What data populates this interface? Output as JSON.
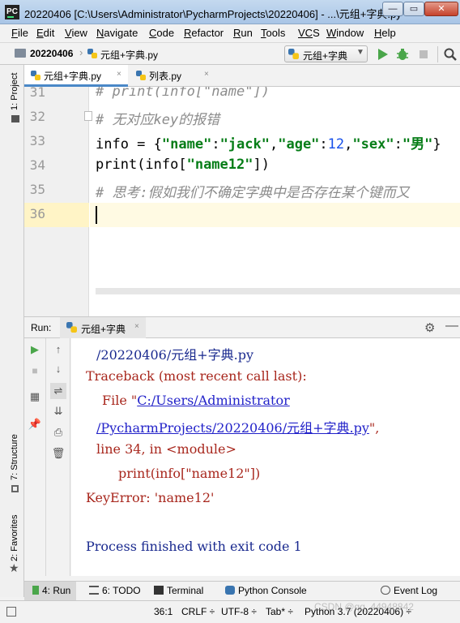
{
  "window": {
    "app_icon_text": "PC",
    "title": "20220406 [C:\\Users\\Administrator\\PycharmProjects\\20220406] - ...\\元组+字典.py",
    "minimize": "—",
    "maximize": "▭",
    "close": "✕"
  },
  "menu": [
    {
      "mn": "F",
      "rest": "ile"
    },
    {
      "mn": "E",
      "rest": "dit"
    },
    {
      "mn": "V",
      "rest": "iew"
    },
    {
      "mn": "N",
      "rest": "avigate"
    },
    {
      "mn": "C",
      "rest": "ode"
    },
    {
      "mn": "R",
      "rest": "efactor"
    },
    {
      "mn": "R",
      "rest": "un"
    },
    {
      "mn": "T",
      "rest": "ools"
    },
    {
      "mn": "VC",
      "rest": "S"
    },
    {
      "mn": "W",
      "rest": "indow"
    },
    {
      "mn": "H",
      "rest": "elp"
    }
  ],
  "nav": {
    "project": "20220406",
    "file": "元组+字典.py",
    "run_config": "元组+字典"
  },
  "left_strip": {
    "project": "1: Project",
    "structure": "7: Structure",
    "favorites": "2: Favorites"
  },
  "tabs": [
    {
      "label": "元组+字典.py",
      "close": "×"
    },
    {
      "label": "列表.py",
      "close": "×"
    }
  ],
  "editor": {
    "line_numbers": [
      "31",
      "32",
      "33",
      "34",
      "35",
      "36"
    ],
    "line31": "# print(info[\"name\"])",
    "line32": "# 无对应key的报错",
    "l33_a": "info = {",
    "l33_s1": "\"name\"",
    "l33_c1": ":",
    "l33_s2": "\"jack\"",
    "l33_c2": ",",
    "l33_s3": "\"age\"",
    "l33_c3": ":",
    "l33_n": "12",
    "l33_c4": ",",
    "l33_s4": "\"sex\"",
    "l33_c5": ":",
    "l33_s5": "\"男\"",
    "l33_end": "}",
    "l34_a": "print(info[",
    "l34_s": "\"name12\"",
    "l34_end": "])",
    "line35": "# 思考:假如我们不确定字典中是否存在某个键而又"
  },
  "run_panel": {
    "label": "Run:",
    "tab": "元组+字典",
    "close": "×",
    "gear": "⚙",
    "minimize": "—"
  },
  "console": {
    "line1": "/20220406/元组+字典.py",
    "line2": "Traceback (most recent call last):",
    "line3_pre": "File \"",
    "line3_link": "C:/Users/Administrator",
    "line4_link": "/PycharmProjects/20220406/元组+字典.py",
    "line4_post": "\",",
    "line5": "line 34, in <module>",
    "line6": "print(info[\"name12\"])",
    "line7": "KeyError: 'name12'",
    "line8": "Process finished with exit code 1"
  },
  "bottom_tabs": {
    "run": "4: Run",
    "todo": "6: TODO",
    "terminal": "Terminal",
    "python_console": "Python Console",
    "event_log": "Event Log"
  },
  "status": {
    "position": "36:1",
    "line_sep": "CRLF ÷",
    "encoding": "UTF-8 ÷",
    "indent": "Tab* ÷",
    "interpreter": "Python 3.7 (20220406) ÷",
    "watermark": "CSDN @qq_44948842"
  },
  "colors": {
    "comment": "#8c8c8c",
    "string": "#067d17",
    "number": "#1750eb",
    "error": "#a8271d",
    "link": "#2222c9",
    "accent": "#4a88c7"
  }
}
